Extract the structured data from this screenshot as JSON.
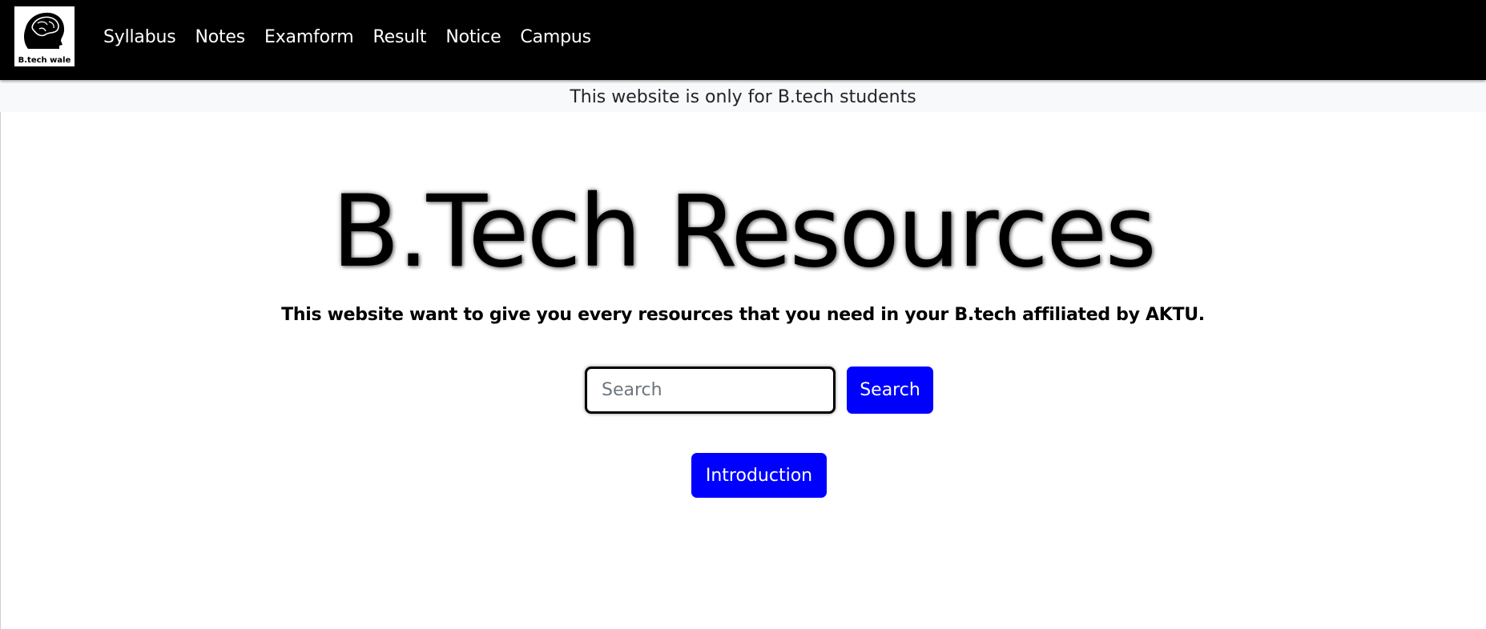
{
  "nav": {
    "logo_caption": "B.tech wale",
    "links": [
      {
        "label": "Syllabus"
      },
      {
        "label": "Notes"
      },
      {
        "label": "Examform"
      },
      {
        "label": "Result"
      },
      {
        "label": "Notice"
      },
      {
        "label": "Campus"
      }
    ]
  },
  "banner": {
    "text": "This website is only for B.tech students"
  },
  "hero": {
    "title": "B.Tech Resources",
    "subtitle": "This website want to give you every resources that you need in your B.tech affiliated by AKTU."
  },
  "search": {
    "placeholder": "Search",
    "value": "",
    "button_label": "Search"
  },
  "intro": {
    "button_label": "Introduction"
  },
  "colors": {
    "navbar_bg": "#000000",
    "accent_button": "#0000ff",
    "banner_bg": "#f8f9fa"
  }
}
